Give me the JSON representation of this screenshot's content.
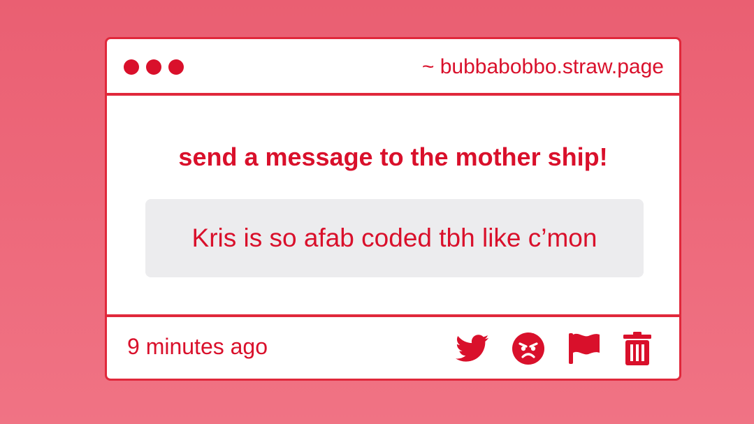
{
  "window": {
    "url": "~ bubbabobbo.straw.page"
  },
  "prompt": {
    "heading": "send a message to the mother ship!"
  },
  "message": {
    "text": "Kris is so afab coded tbh like c’mon",
    "timestamp": "9 minutes ago"
  },
  "actions": [
    {
      "icon": "twitter-icon"
    },
    {
      "icon": "angry-face-icon"
    },
    {
      "icon": "flag-icon"
    },
    {
      "icon": "trash-icon"
    }
  ],
  "colors": {
    "accent": "#d9102b",
    "border": "#e0283b",
    "background": "#ea5f72",
    "message_bg": "#ececee"
  }
}
